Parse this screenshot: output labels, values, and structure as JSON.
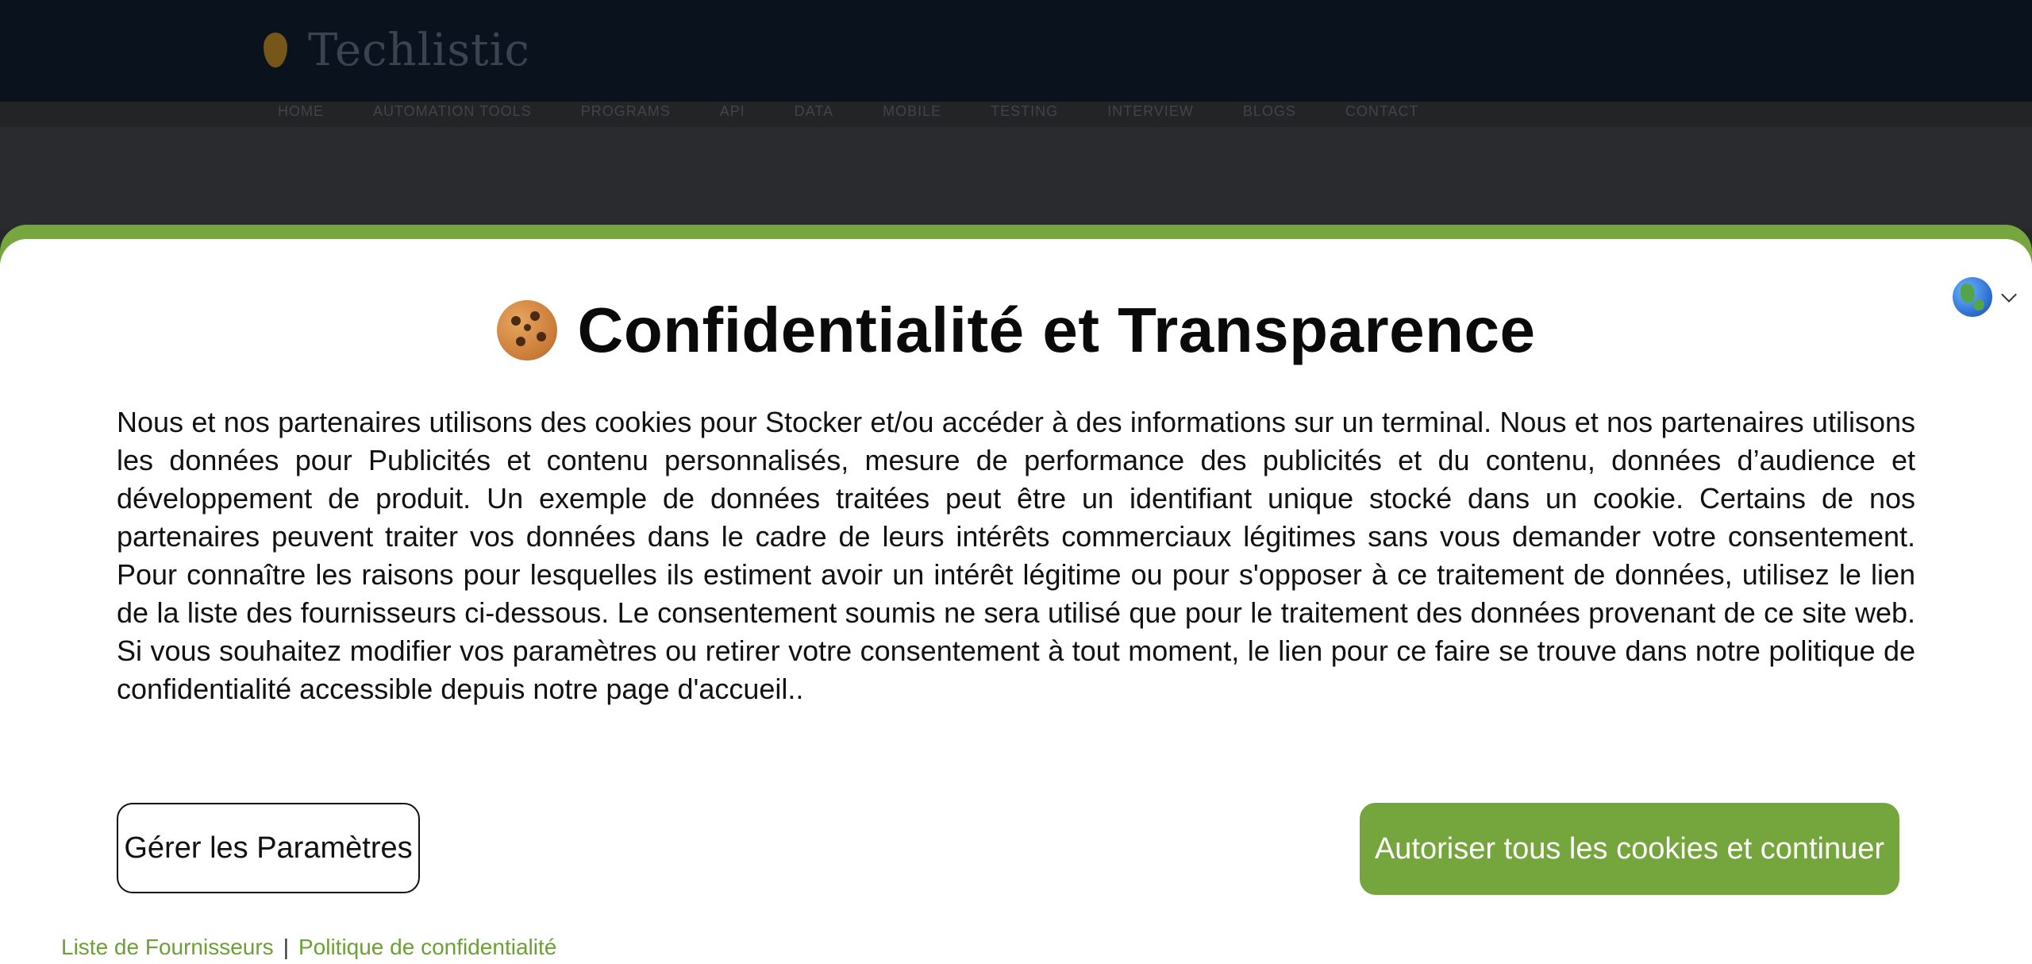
{
  "site": {
    "brand": "Techlistic",
    "nav": [
      "HOME",
      "AUTOMATION TOOLS",
      "PROGRAMS",
      "API",
      "DATA",
      "MOBILE",
      "TESTING",
      "INTERVIEW",
      "BLOGS",
      "CONTACT"
    ]
  },
  "consent": {
    "title": "Confidentialité et Transparence",
    "body": "Nous et nos partenaires utilisons des cookies pour Stocker et/ou accéder à des informations sur un terminal. Nous et nos partenaires utilisons les données pour Publicités et contenu personnalisés, mesure de performance des publicités et du contenu, données d’audience et développement de produit. Un exemple de données traitées peut être un identifiant unique stocké dans un cookie. Certains de nos partenaires peuvent traiter vos données dans le cadre de leurs intérêts commerciaux légitimes sans vous demander votre consentement. Pour connaître les raisons pour lesquelles ils estiment avoir un intérêt légitime ou pour s'opposer à ce traitement de données, utilisez le lien de la liste des fournisseurs ci-dessous. Le consentement soumis ne sera utilisé que pour le traitement des données provenant de ce site web. Si vous souhaitez modifier vos paramètres ou retirer votre consentement à tout moment, le lien pour ce faire se trouve dans notre politique de confidentialité accessible depuis notre page d'accueil..",
    "manage_label": "Gérer les Paramètres",
    "accept_label": "Autoriser tous les cookies et continuer",
    "vendors_link": "Liste de Fournisseurs",
    "separator": "|",
    "privacy_link": "Politique de confidentialité",
    "language_icon": "globe-icon",
    "cookie_icon": "cookie-icon"
  },
  "colors": {
    "accent": "#75a53d",
    "link": "#6c9f35",
    "header_bg": "#0b1521"
  }
}
